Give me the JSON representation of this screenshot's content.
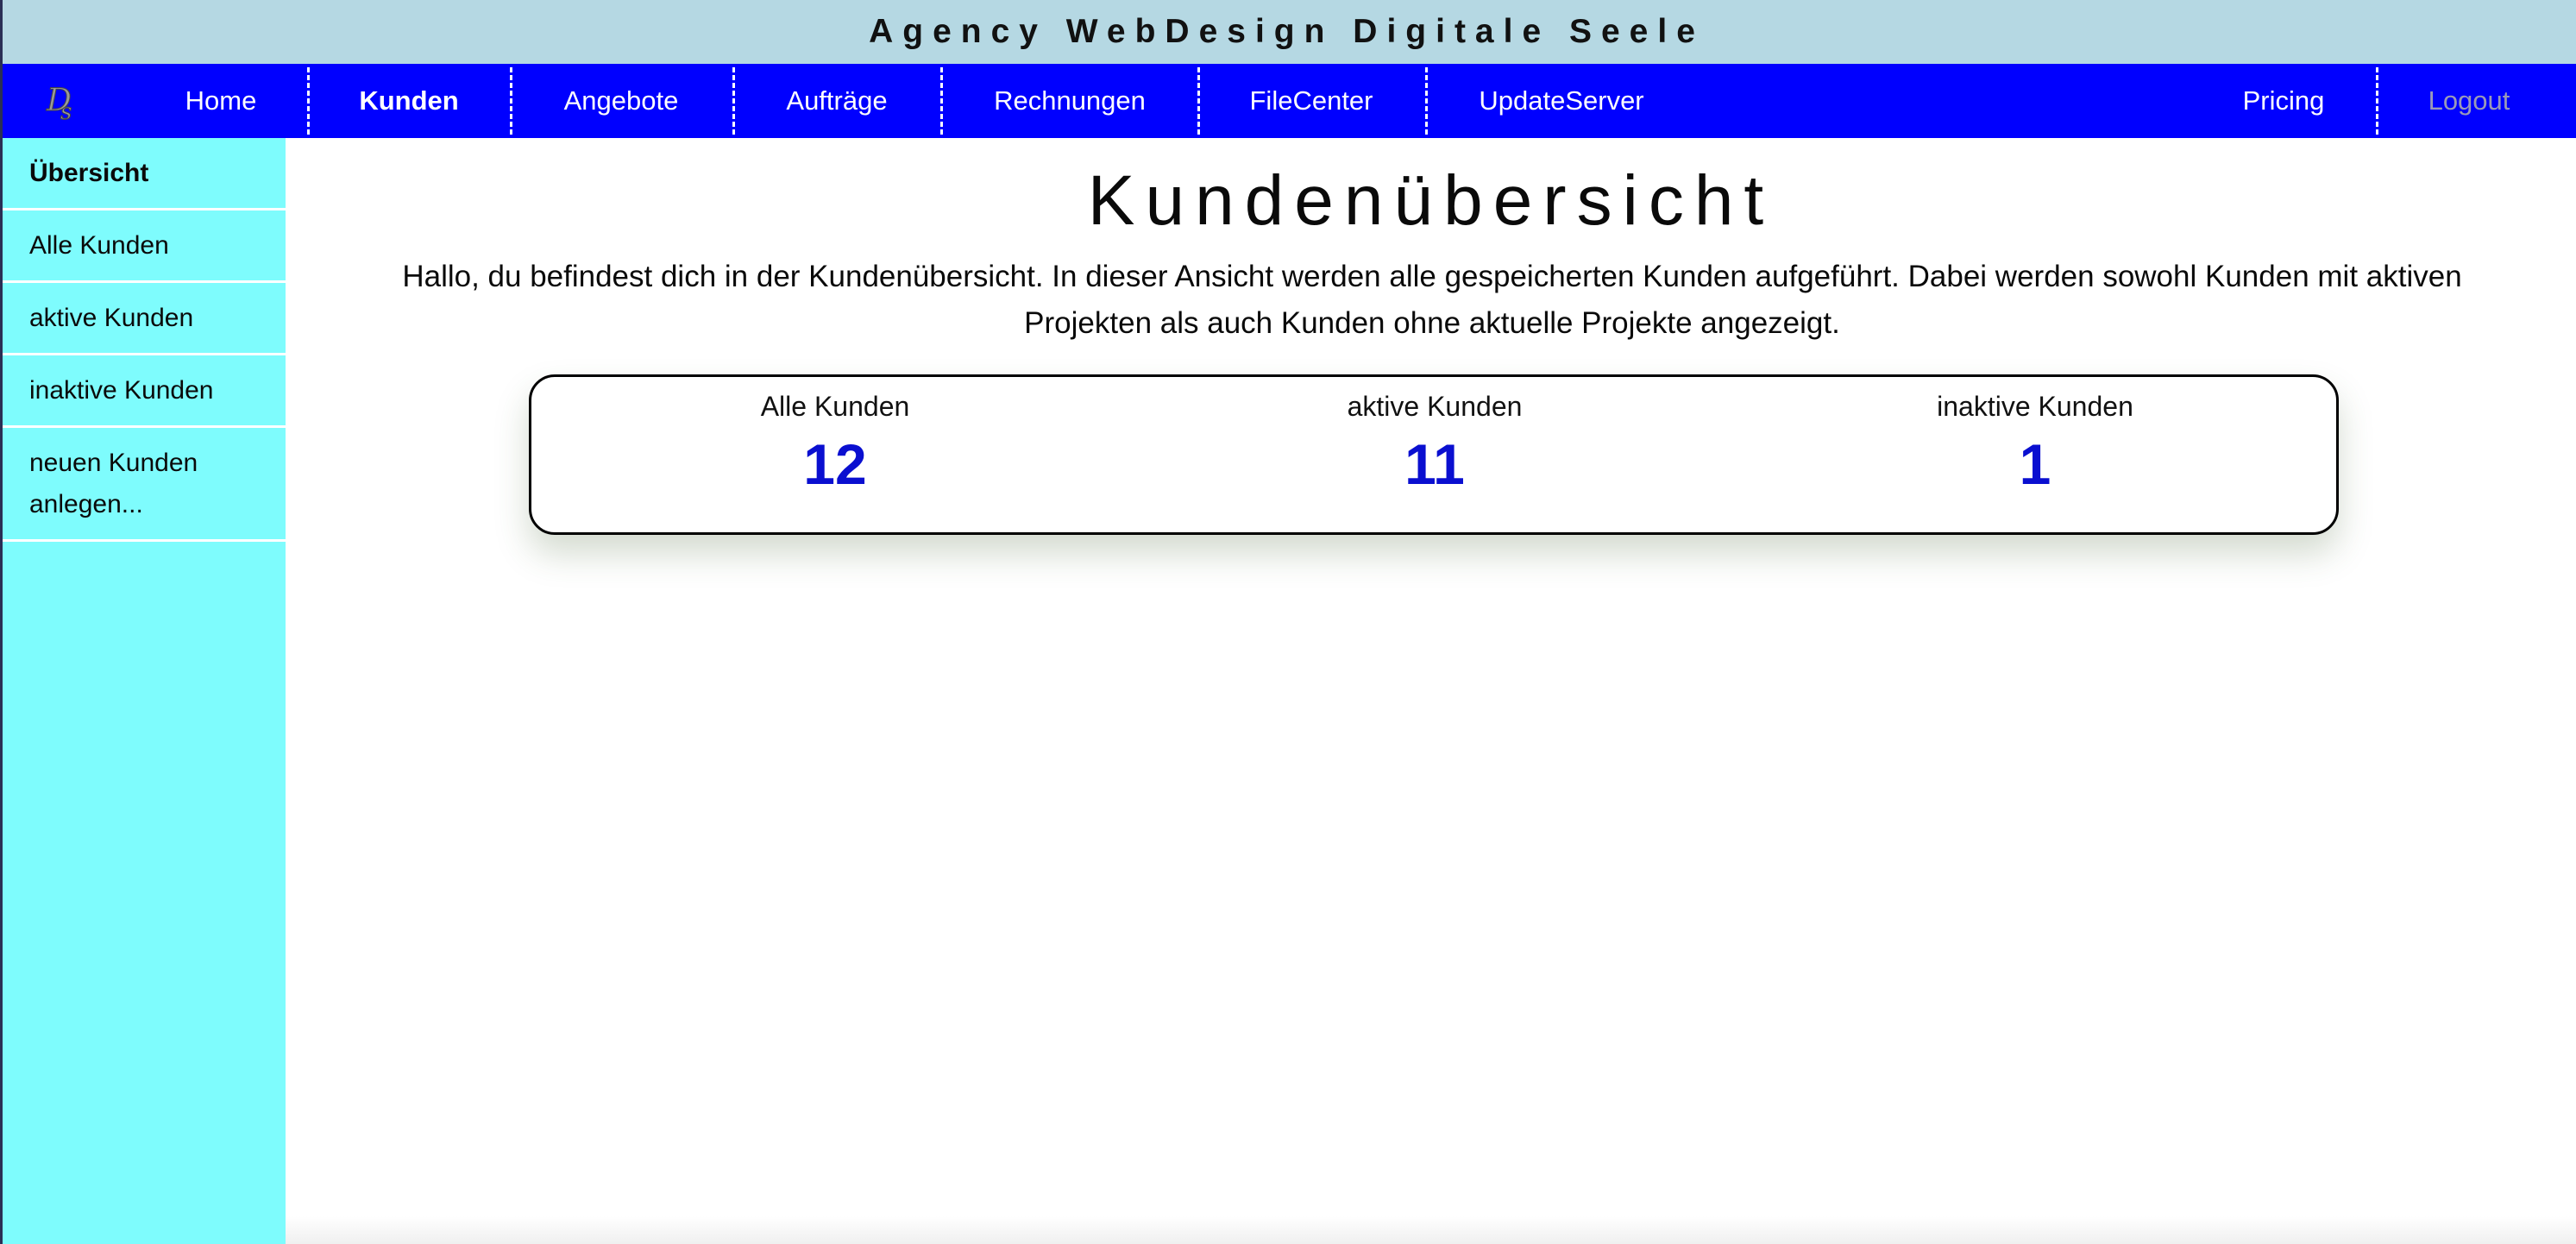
{
  "banner": {
    "title": "Agency WebDesign Digitale Seele"
  },
  "navbar": {
    "logo": "Ds",
    "items": [
      {
        "label": "Home"
      },
      {
        "label": "Kunden"
      },
      {
        "label": "Angebote"
      },
      {
        "label": "Aufträge"
      },
      {
        "label": "Rechnungen"
      },
      {
        "label": "FileCenter"
      },
      {
        "label": "UpdateServer"
      }
    ],
    "right": [
      {
        "label": "Pricing"
      },
      {
        "label": "Logout"
      }
    ],
    "active": "Kunden"
  },
  "sidebar": {
    "items": [
      {
        "label": "Übersicht"
      },
      {
        "label": "Alle Kunden"
      },
      {
        "label": "aktive Kunden"
      },
      {
        "label": "inaktive Kunden"
      },
      {
        "label": "neuen Kunden anlegen..."
      }
    ],
    "active": "Übersicht"
  },
  "main": {
    "title": "Kundenübersicht",
    "intro": "Hallo, du befindest dich in der Kundenübersicht. In dieser Ansicht werden alle gespeicherten Kunden aufgeführt. Dabei werden sowohl Kunden mit aktiven Projekten als auch Kunden ohne aktuelle Projekte angezeigt.",
    "stats": [
      {
        "label": "Alle Kunden",
        "value": "12"
      },
      {
        "label": "aktive Kunden",
        "value": "11"
      },
      {
        "label": "inaktive Kunden",
        "value": "1"
      }
    ]
  },
  "colors": {
    "banner": "#b5d8e3",
    "navbar": "#0000ff",
    "sidebar": "#7efcfd",
    "stat_value": "#0a0fd0",
    "logout_text": "#9a9ab8"
  }
}
